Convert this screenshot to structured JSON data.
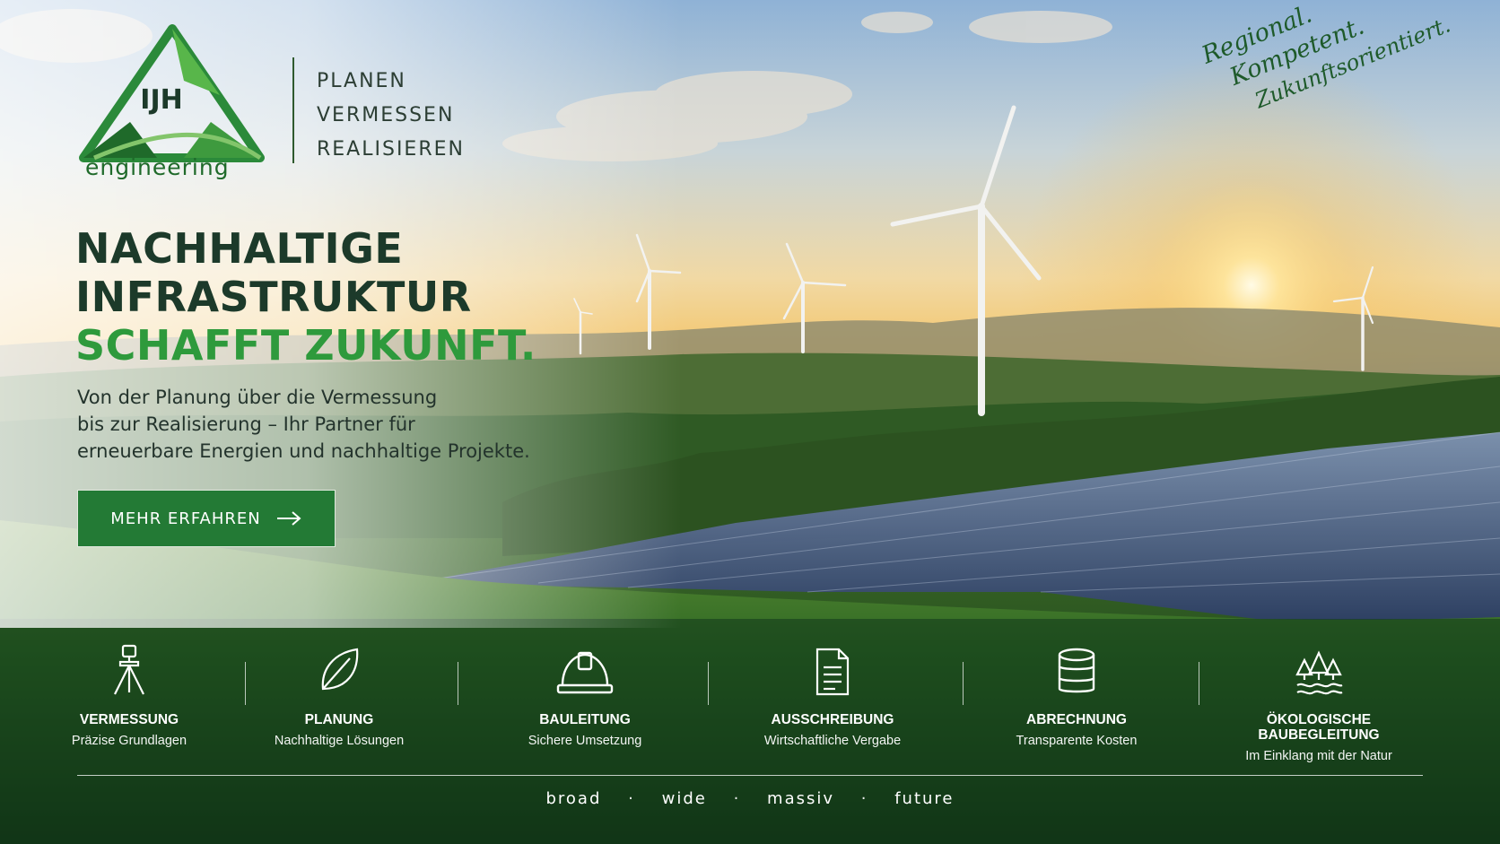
{
  "brand": {
    "logo_mark": "IJH",
    "logo_word": "engineering",
    "tagline": [
      "PLANEN",
      "VERMESSEN",
      "REALISIEREN"
    ]
  },
  "script_text": [
    "Regional.",
    "Kompetent.",
    "Zukunftsorientiert."
  ],
  "hero": {
    "headline_line1": "NACHHALTIGE",
    "headline_line2": "INFRASTRUKTUR",
    "headline_line3": "SCHAFFT ZUKUNFT.",
    "subtitle_line1": "Von der Planung über die Vermessung",
    "subtitle_line2": "bis zur Realisierung – Ihr Partner für",
    "subtitle_line3": "erneuerbare Energien und nachhaltige Projekte."
  },
  "cta": {
    "label": "MEHR ERFAHREN",
    "icon": "arrow-right-icon"
  },
  "services": [
    {
      "title": "VERMESSUNG",
      "desc": "Präzise Grundlagen",
      "icon": "theodolite-icon"
    },
    {
      "title": "PLANUNG",
      "desc": "Nachhaltige Lösungen",
      "icon": "leaf-icon"
    },
    {
      "title": "BAULEITUNG",
      "desc": "Sichere Umsetzung",
      "icon": "hardhat-icon"
    },
    {
      "title": "AUSSCHREIBUNG",
      "desc": "Wirtschaftliche Vergabe",
      "icon": "document-icon"
    },
    {
      "title": "ABRECHNUNG",
      "desc": "Transparente Kosten",
      "icon": "coins-icon"
    },
    {
      "title": "ÖKOLOGISCHE BAUBEGLEITUNG",
      "desc": "Im Einklang mit der Natur",
      "icon": "trees-water-icon"
    }
  ],
  "footer": [
    "broad",
    "wide",
    "massiv",
    "future"
  ],
  "colors": {
    "brand_green": "#237a35",
    "headline_dark": "#1c3a2a",
    "headline_green": "#2e9a3c"
  }
}
